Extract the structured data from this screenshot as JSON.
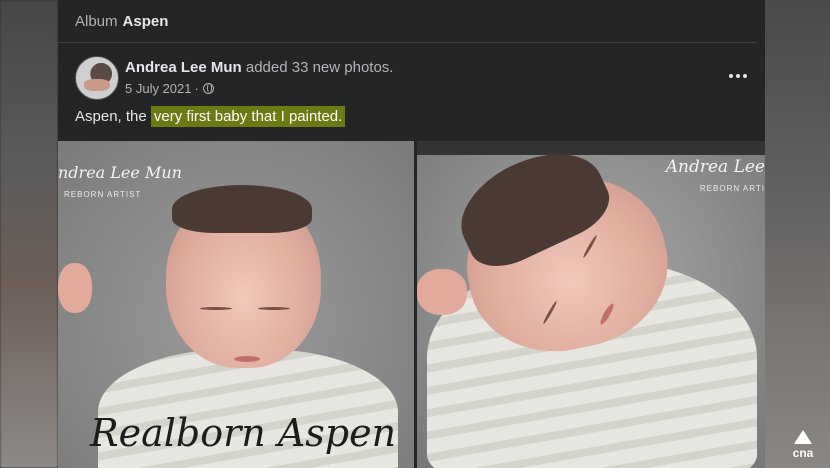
{
  "album": {
    "prefix": "Album",
    "name": "Aspen"
  },
  "post": {
    "author": "Andrea Lee Mun",
    "action": "added 33 new photos.",
    "date": "5 July 2021",
    "date_separator": "·",
    "caption_plain": "Aspen, the ",
    "caption_highlight": "very first baby that I painted.",
    "more_icon": "more-horizontal-icon",
    "privacy_icon": "globe-icon"
  },
  "photos": [
    {
      "watermark": "ndrea Lee Mun",
      "watermark_sub": "REBORN ARTIST",
      "overlay_text": "Realborn Aspen"
    },
    {
      "watermark": "Andrea Lee",
      "watermark_sub": "REBORN ARTI"
    }
  ],
  "broadcaster": {
    "logo_text": "cna"
  },
  "colors": {
    "highlight": "#6b7a12",
    "panel": "#242526"
  }
}
